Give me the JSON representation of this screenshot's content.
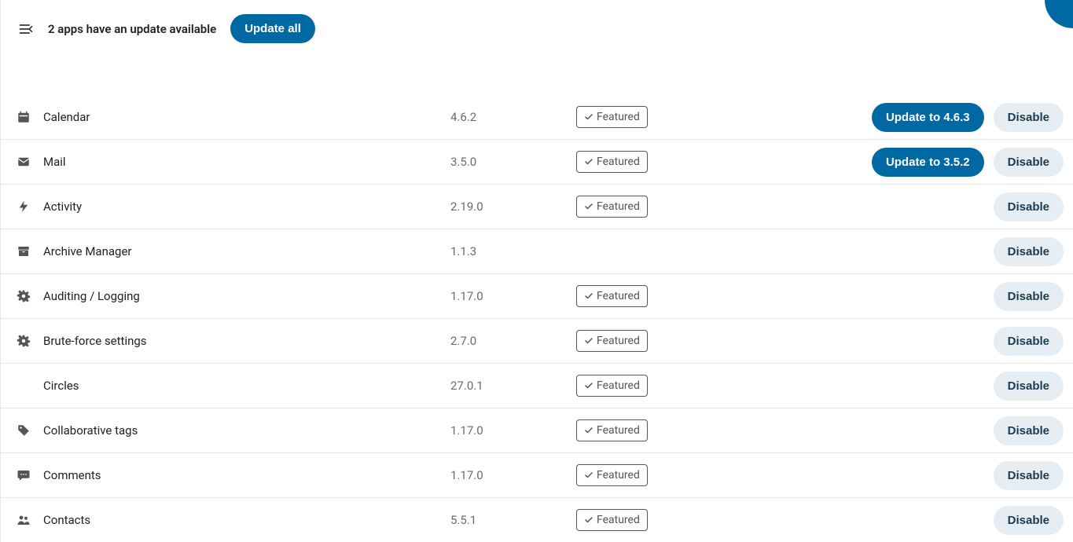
{
  "banner": {
    "text": "2 apps have an update available",
    "updateAll": "Update all"
  },
  "labels": {
    "featured": "Featured",
    "disable": "Disable",
    "updatePrefix": "Update to "
  },
  "apps": [
    {
      "icon": "calendar",
      "name": "Calendar",
      "version": "4.6.2",
      "featured": true,
      "updateTo": "4.6.3"
    },
    {
      "icon": "mail",
      "name": "Mail",
      "version": "3.5.0",
      "featured": true,
      "updateTo": "3.5.2"
    },
    {
      "icon": "bolt",
      "name": "Activity",
      "version": "2.19.0",
      "featured": true,
      "updateTo": null
    },
    {
      "icon": "archive",
      "name": "Archive Manager",
      "version": "1.1.3",
      "featured": false,
      "updateTo": null
    },
    {
      "icon": "gear",
      "name": "Auditing / Logging",
      "version": "1.17.0",
      "featured": true,
      "updateTo": null
    },
    {
      "icon": "gear",
      "name": "Brute-force settings",
      "version": "2.7.0",
      "featured": true,
      "updateTo": null
    },
    {
      "icon": "",
      "name": "Circles",
      "version": "27.0.1",
      "featured": true,
      "updateTo": null
    },
    {
      "icon": "tag",
      "name": "Collaborative tags",
      "version": "1.17.0",
      "featured": true,
      "updateTo": null
    },
    {
      "icon": "comment",
      "name": "Comments",
      "version": "1.17.0",
      "featured": true,
      "updateTo": null
    },
    {
      "icon": "contacts",
      "name": "Contacts",
      "version": "5.5.1",
      "featured": true,
      "updateTo": null
    }
  ]
}
